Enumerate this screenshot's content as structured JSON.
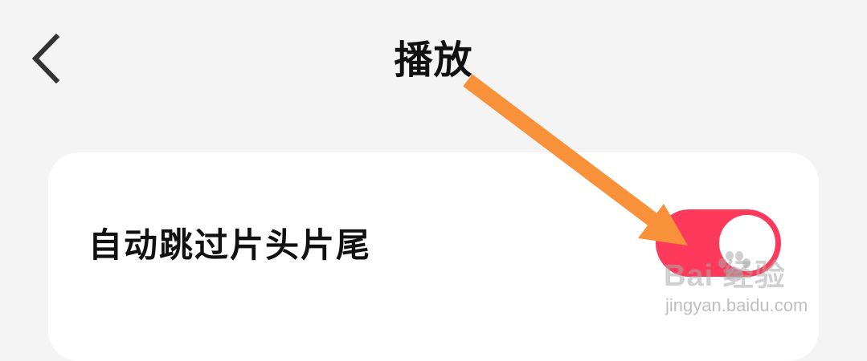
{
  "header": {
    "back_icon": "chevron-left-icon",
    "title": "播放"
  },
  "settings": {
    "items": [
      {
        "label": "自动跳过片头片尾",
        "toggle_on": true
      }
    ]
  },
  "colors": {
    "background": "#f4f4f4",
    "card": "#ffffff",
    "toggle_active": "#fe3a5c",
    "annotation_arrow": "#f8913a"
  },
  "watermark": {
    "brand": "Bai 经验",
    "url": "jingyan.baidu.com"
  }
}
